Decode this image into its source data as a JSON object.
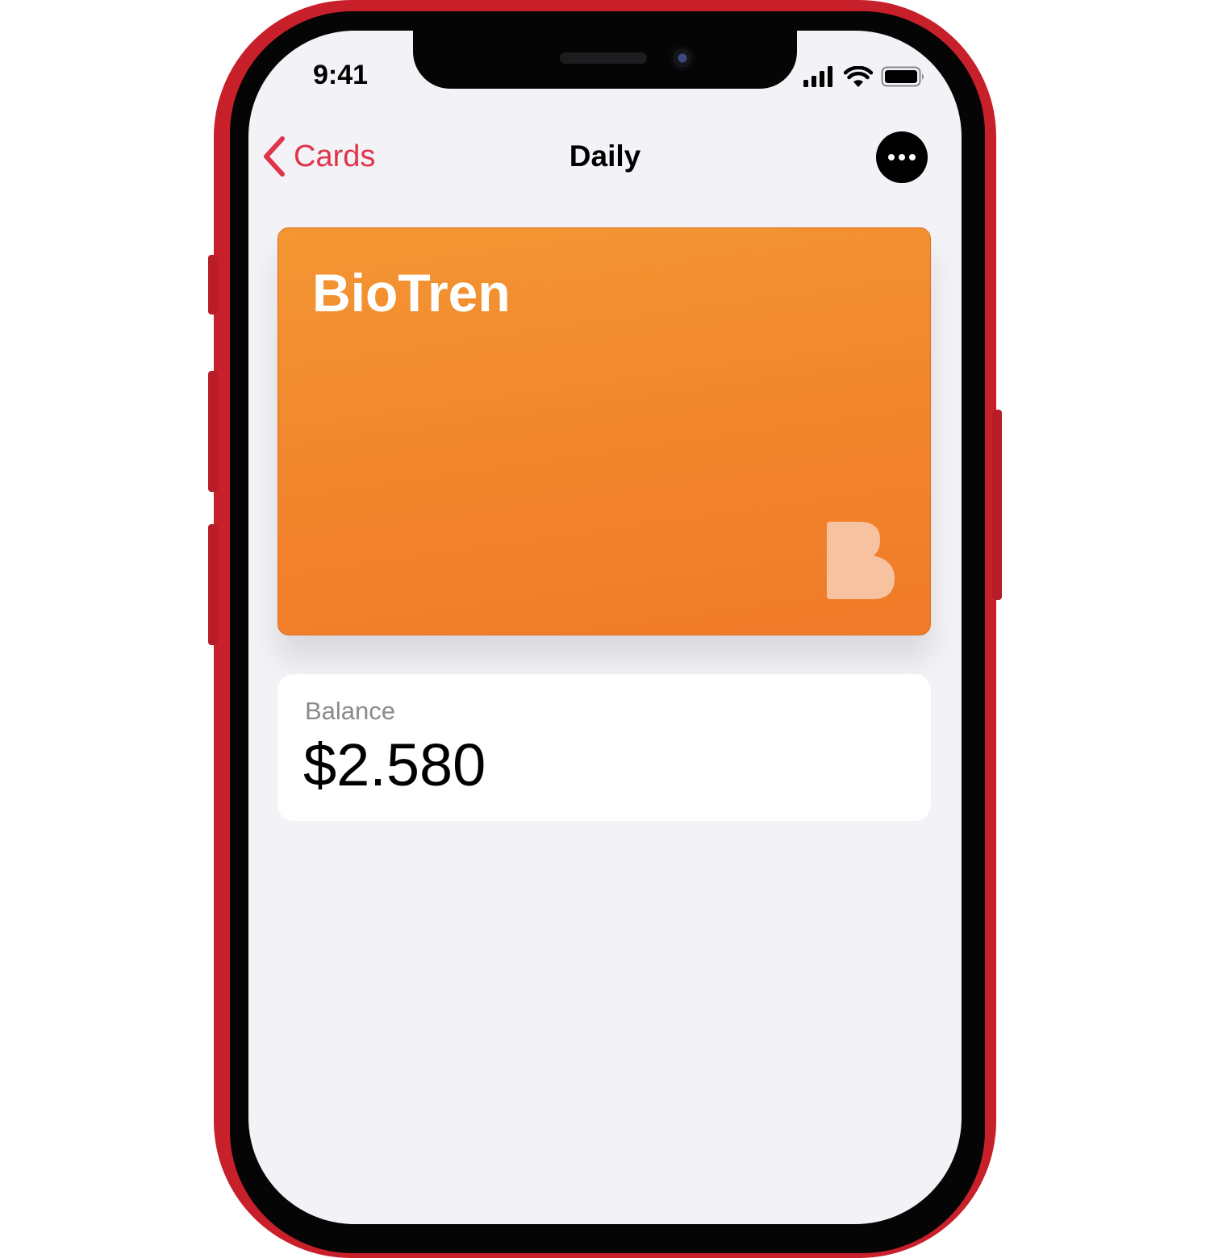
{
  "status_bar": {
    "time": "9:41",
    "icons": [
      "cellular-signal-icon",
      "wifi-icon",
      "battery-icon"
    ]
  },
  "nav": {
    "back_label": "Cards",
    "title": "Daily",
    "more_icon": "ellipsis-icon"
  },
  "card": {
    "name": "BioTren",
    "logo": "biotren-b-logo",
    "color": "#F2852C"
  },
  "balance": {
    "label": "Balance",
    "value": "$2.580"
  },
  "colors": {
    "accent": "#E0344A",
    "phone_frame": "#C8202A",
    "screen_background": "#F2F2F7"
  }
}
